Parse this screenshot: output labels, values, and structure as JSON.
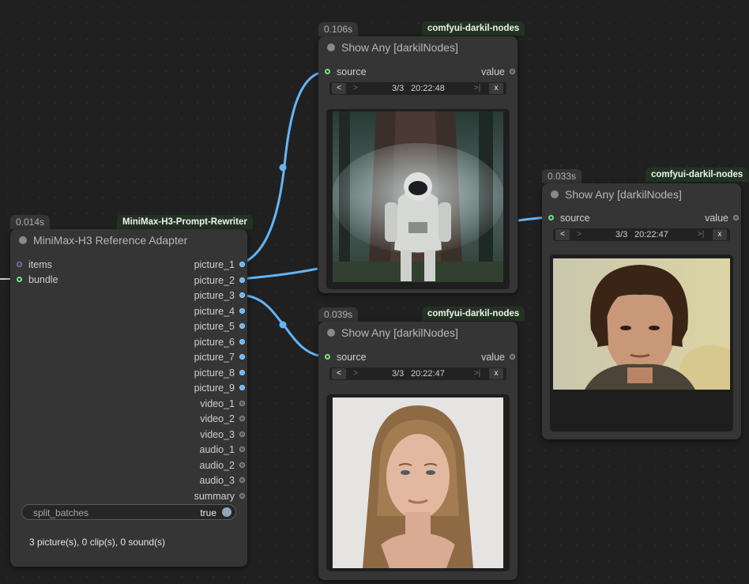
{
  "colors": {
    "canvas": "#202020",
    "node_bg": "#353535",
    "image_link": "#64b5f6",
    "source_badge_bg": "#223322"
  },
  "adapter_node": {
    "time": "0.014s",
    "source": "MiniMax-H3-Prompt-Rewriter",
    "title": "MiniMax-H3 Reference Adapter",
    "inputs": [
      "items",
      "bundle"
    ],
    "outputs": [
      "picture_1",
      "picture_2",
      "picture_3",
      "picture_4",
      "picture_5",
      "picture_6",
      "picture_7",
      "picture_8",
      "picture_9",
      "video_1",
      "video_2",
      "video_3",
      "audio_1",
      "audio_2",
      "audio_3",
      "summary"
    ],
    "widget": {
      "label": "split_batches",
      "value": "true"
    },
    "summary": "3 picture(s), 0 clip(s), 0 sound(s)"
  },
  "show_nodes": [
    {
      "time": "0.106s",
      "source": "comfyui-darkil-nodes",
      "title": "Show Any [darkilNodes]",
      "input": "source",
      "output": "value",
      "nav": {
        "prev": "<",
        "next": ">",
        "position": "3/3",
        "time": "20:22:48",
        "last": ">|",
        "close": "x"
      },
      "image_icon": "astronaut-in-forest-image"
    },
    {
      "time": "0.039s",
      "source": "comfyui-darkil-nodes",
      "title": "Show Any [darkilNodes]",
      "input": "source",
      "output": "value",
      "nav": {
        "prev": "<",
        "next": ">",
        "position": "3/3",
        "time": "20:22:47",
        "last": ">|",
        "close": "x"
      },
      "image_icon": "woman-portrait-image"
    },
    {
      "time": "0.033s",
      "source": "comfyui-darkil-nodes",
      "title": "Show Any [darkilNodes]",
      "input": "source",
      "output": "value",
      "nav": {
        "prev": "<",
        "next": ">",
        "position": "3/3",
        "time": "20:22:47",
        "last": ">|",
        "close": "x"
      },
      "image_icon": "man-portrait-image"
    }
  ]
}
